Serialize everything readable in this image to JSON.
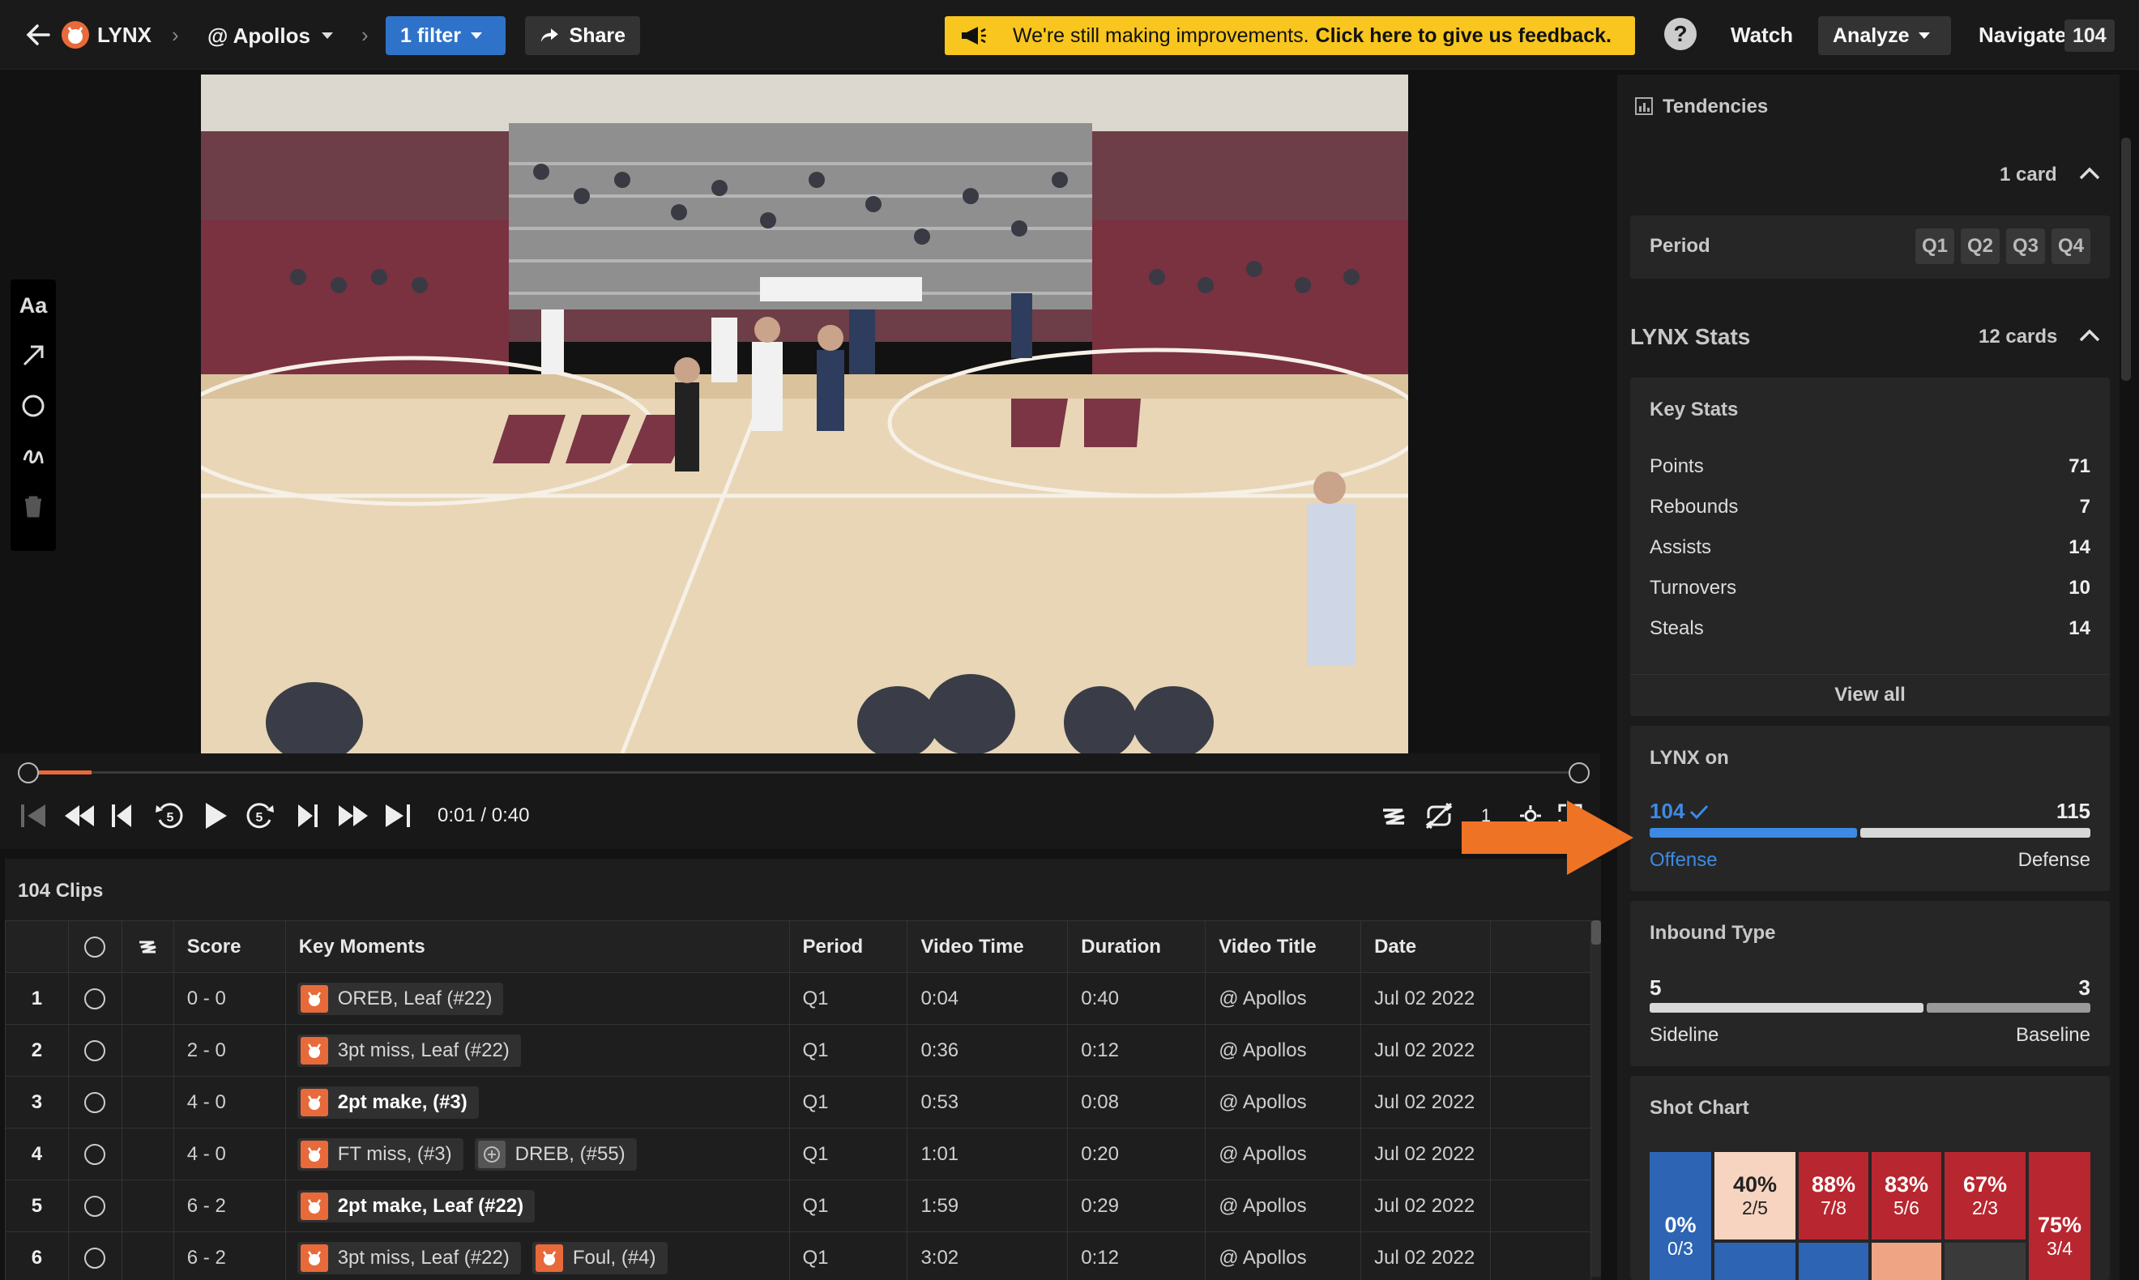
{
  "topbar": {
    "team": "LYNX",
    "opponent": "@ Apollos",
    "filter_label": "1 filter",
    "share_label": "Share",
    "feedback_text": "We're still making improvements.",
    "feedback_link": "Click here to give us feedback.",
    "help_label": "?",
    "watch_label": "Watch",
    "analyze_label": "Analyze",
    "navigate_label": "Navigate",
    "navigate_count": "104"
  },
  "draw_tools": {
    "text_tool_label": "Aa"
  },
  "player": {
    "time": "0:01 / 0:40",
    "progress_fraction": 0.04,
    "volume_label": "1"
  },
  "clips": {
    "count_label": "104 Clips",
    "columns": [
      "Score",
      "Key Moments",
      "Period",
      "Video Time",
      "Duration",
      "Video Title",
      "Date"
    ],
    "rows": [
      {
        "n": "1",
        "score": "0 - 0",
        "moments": [
          {
            "label": "OREB, Leaf (#22)",
            "bold": false,
            "logo": "team"
          }
        ],
        "period": "Q1",
        "video_time": "0:04",
        "duration": "0:40",
        "title": "@ Apollos",
        "date": "Jul 02 2022"
      },
      {
        "n": "2",
        "score": "2 - 0",
        "moments": [
          {
            "label": "3pt miss, Leaf (#22)",
            "bold": false,
            "logo": "team"
          }
        ],
        "period": "Q1",
        "video_time": "0:36",
        "duration": "0:12",
        "title": "@ Apollos",
        "date": "Jul 02 2022"
      },
      {
        "n": "3",
        "score": "4 - 0",
        "moments": [
          {
            "label": "2pt make, (#3)",
            "bold": true,
            "logo": "team"
          }
        ],
        "period": "Q1",
        "video_time": "0:53",
        "duration": "0:08",
        "title": "@ Apollos",
        "date": "Jul 02 2022"
      },
      {
        "n": "4",
        "score": "4 - 0",
        "moments": [
          {
            "label": "FT miss, (#3)",
            "bold": false,
            "logo": "team"
          },
          {
            "label": "DREB, (#55)",
            "bold": false,
            "logo": "opponent"
          }
        ],
        "period": "Q1",
        "video_time": "1:01",
        "duration": "0:20",
        "title": "@ Apollos",
        "date": "Jul 02 2022"
      },
      {
        "n": "5",
        "score": "6 - 2",
        "moments": [
          {
            "label": "2pt make, Leaf (#22)",
            "bold": true,
            "logo": "team"
          }
        ],
        "period": "Q1",
        "video_time": "1:59",
        "duration": "0:29",
        "title": "@ Apollos",
        "date": "Jul 02 2022"
      },
      {
        "n": "6",
        "score": "6 - 2",
        "moments": [
          {
            "label": "3pt miss, Leaf (#22)",
            "bold": false,
            "logo": "team"
          },
          {
            "label": "Foul, (#4)",
            "bold": false,
            "logo": "team"
          }
        ],
        "period": "Q1",
        "video_time": "3:02",
        "duration": "0:12",
        "title": "@ Apollos",
        "date": "Jul 02 2022"
      }
    ]
  },
  "panel": {
    "tendencies_title": "Tendencies",
    "tendencies_count": "1 card",
    "period_label": "Period",
    "quarters": [
      "Q1",
      "Q2",
      "Q3",
      "Q4"
    ],
    "stats_title": "LYNX Stats",
    "stats_count": "12 cards",
    "key_stats": {
      "title": "Key Stats",
      "items": [
        {
          "label": "Points",
          "value": "71"
        },
        {
          "label": "Rebounds",
          "value": "7"
        },
        {
          "label": "Assists",
          "value": "14"
        },
        {
          "label": "Turnovers",
          "value": "10"
        },
        {
          "label": "Steals",
          "value": "14"
        }
      ],
      "view_all": "View all"
    },
    "lynx_on": {
      "title": "LYNX on",
      "left_value": "104",
      "right_value": "115",
      "left_label": "Offense",
      "right_label": "Defense"
    },
    "inbound": {
      "title": "Inbound Type",
      "left_value": "5",
      "right_value": "3",
      "left_label": "Sideline",
      "right_label": "Baseline"
    },
    "shot_chart": {
      "title": "Shot Chart",
      "zones": [
        {
          "pct": "0%",
          "frac": "0/3"
        },
        {
          "pct": "40%",
          "frac": "2/5"
        },
        {
          "pct": "88%",
          "frac": "7/8"
        },
        {
          "pct": "83%",
          "frac": "5/6"
        },
        {
          "pct": "67%",
          "frac": "2/3"
        },
        {
          "pct": "75%",
          "frac": "3/4"
        }
      ]
    }
  },
  "colors": {
    "accent_blue": "#2e73c9",
    "feedback_yellow": "#f8c61e",
    "brand_orange": "#e86a3a",
    "arrow_orange": "#ee7325",
    "hot_red": "#b8262f",
    "cold_blue": "#2d64b4"
  }
}
